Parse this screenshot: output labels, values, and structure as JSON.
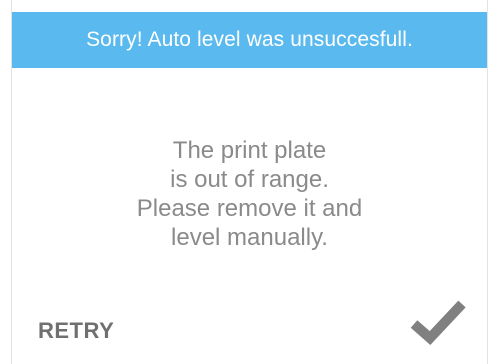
{
  "header": {
    "title": "Sorry! Auto level was unsuccesfull."
  },
  "message": {
    "lines": [
      "The print plate",
      "is out of range.",
      "Please remove it and",
      "level manually."
    ]
  },
  "actions": {
    "retry_label": "RETRY",
    "confirm_icon": "checkmark-icon"
  },
  "colors": {
    "header_background": "#5ab9ee",
    "header_text": "#ffffff",
    "body_text": "#8a8a8a",
    "action_text": "#707070",
    "checkmark": "#808080"
  }
}
